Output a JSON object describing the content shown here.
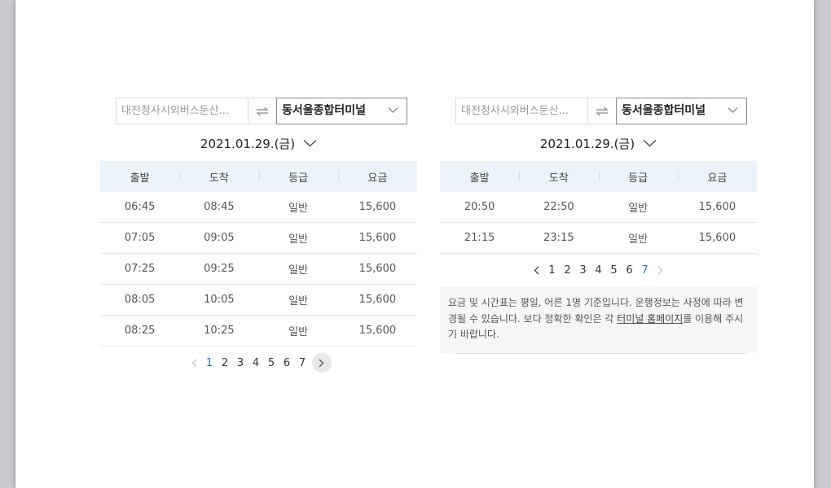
{
  "left": {
    "departure": "대전청사시외버스둔산...",
    "arrival": "동서울종합터미널",
    "date": "2021.01.29.(금)",
    "headers": [
      "출발",
      "도착",
      "등급",
      "요금"
    ],
    "rows": [
      [
        "06:45",
        "08:45",
        "일반",
        "15,600"
      ],
      [
        "07:05",
        "09:05",
        "일반",
        "15,600"
      ],
      [
        "07:25",
        "09:25",
        "일반",
        "15,600"
      ],
      [
        "08:05",
        "10:05",
        "일반",
        "15,600"
      ],
      [
        "08:25",
        "10:25",
        "일반",
        "15,600"
      ]
    ],
    "pages": [
      "1",
      "2",
      "3",
      "4",
      "5",
      "6",
      "7"
    ],
    "active_page": "1"
  },
  "right": {
    "departure": "대전청사시외버스둔산...",
    "arrival": "동서울종합터미널",
    "date": "2021.01.29.(금)",
    "headers": [
      "출발",
      "도착",
      "등급",
      "요금"
    ],
    "rows": [
      [
        "20:50",
        "22:50",
        "일반",
        "15,600"
      ],
      [
        "21:15",
        "23:15",
        "일반",
        "15,600"
      ]
    ],
    "pages": [
      "1",
      "2",
      "3",
      "4",
      "5",
      "6",
      "7"
    ],
    "active_page": "7",
    "notice": {
      "text_before": "요금 및 시간표는 평일, 어른 1명 기준입니다. 운행정보는 사정에 따라 변경될 수 있습니다. 보다 정확한 확인은 각 ",
      "link": "터미널 홈페이지",
      "text_after": "를 이용해 주시기 바랍니다."
    }
  },
  "colors": {
    "accent": "#1f74d4",
    "header_bg": "#ecf3fa",
    "page_bg": "#ffffff"
  },
  "icons": {
    "swap": "swap-arrows-icon",
    "chevron": "chevron-down-icon",
    "prev": "chevron-left-icon",
    "next": "chevron-right-icon"
  }
}
